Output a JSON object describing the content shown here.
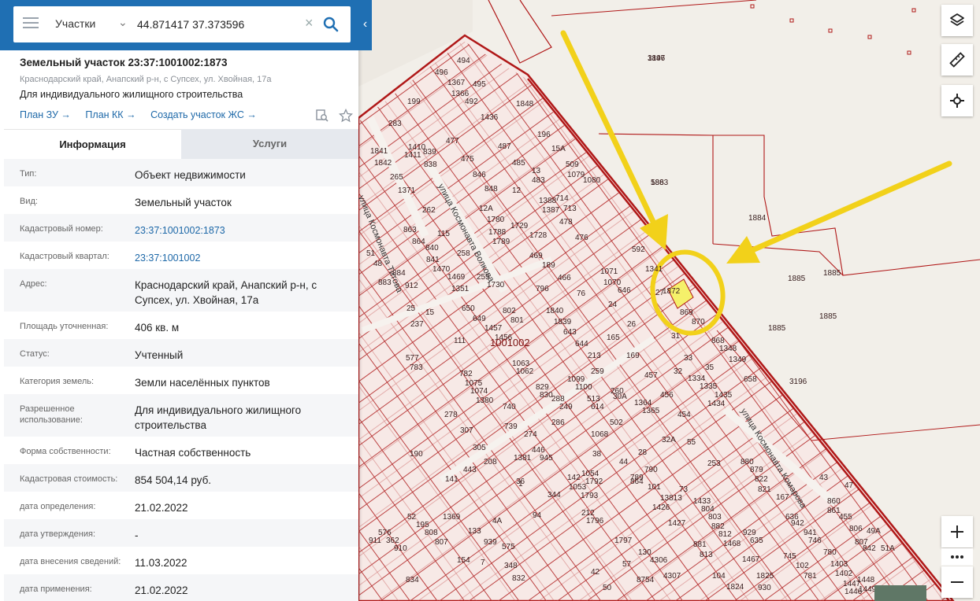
{
  "search": {
    "type_label": "Участки",
    "query": "44.871417 37.373596"
  },
  "header": {
    "title": "Земельный участок 23:37:1001002:1873",
    "address_short": "Краснодарский край, Анапский р-н, с Супсех, ул. Хвойная, 17а",
    "purpose": "Для индивидуального жилищного строительства",
    "links": [
      "План ЗУ →",
      "План КК →",
      "Создать участок ЖС →"
    ]
  },
  "tabs": {
    "info": "Информация",
    "services": "Услуги"
  },
  "rows": [
    {
      "label": "Тип:",
      "value": "Объект недвижимости"
    },
    {
      "label": "Вид:",
      "value": "Земельный участок"
    },
    {
      "label": "Кадастровый номер:",
      "value": "23:37:1001002:1873",
      "link": true
    },
    {
      "label": "Кадастровый квартал:",
      "value": "23:37:1001002",
      "link": true
    },
    {
      "label": "Адрес:",
      "value": "Краснодарский край, Анапский р-н, с Супсех, ул. Хвойная, 17а"
    },
    {
      "label": "Площадь уточненная:",
      "value": "406 кв. м"
    },
    {
      "label": "Статус:",
      "value": "Учтенный"
    },
    {
      "label": "Категория земель:",
      "value": "Земли населённых пунктов"
    },
    {
      "label": "Разрешенное использование:",
      "value": "Для индивидуального жилищного строительства"
    },
    {
      "label": "Форма собственности:",
      "value": "Частная собственность"
    },
    {
      "label": "Кадастровая стоимость:",
      "value": "854 504,14 руб."
    },
    {
      "label": "дата определения:",
      "value": "21.02.2022"
    },
    {
      "label": "дата утверждения:",
      "value": "-"
    },
    {
      "label": "дата внесения сведений:",
      "value": "11.03.2022"
    },
    {
      "label": "дата применения:",
      "value": "21.02.2022"
    }
  ],
  "map": {
    "quarter_label": "1001002",
    "streets": [
      "улица Космонавта Титова",
      "улица Космонавта Волкова",
      "улица Космонавта Комарова"
    ],
    "parcel_labels": [
      "3196",
      "1883",
      "1884",
      "1885",
      "1885",
      "1885",
      "1885",
      "3196",
      "1872",
      "869",
      "870",
      "868",
      "1348",
      "1349",
      "658",
      "1341",
      "592",
      "1071",
      "1070",
      "646",
      "76",
      "466",
      "796",
      "1840",
      "1839",
      "643",
      "644",
      "213",
      "165",
      "169",
      "24",
      "26",
      "27",
      "31",
      "33",
      "32",
      "35",
      "1334",
      "1335",
      "1435",
      "1434",
      "454",
      "456",
      "457",
      "1365",
      "1364",
      "259",
      "260",
      "30А",
      "32А",
      "55",
      "253",
      "73",
      "880",
      "879",
      "822",
      "821",
      "167",
      "860",
      "861",
      "43",
      "47",
      "455",
      "49А",
      "806",
      "807",
      "842",
      "51А",
      "1403",
      "1402",
      "1447",
      "1446",
      "1448",
      "1449",
      "190",
      "714",
      "713",
      "476",
      "478",
      "1388",
      "1387",
      "483",
      "13",
      "485",
      "487",
      "1436",
      "492",
      "495",
      "494",
      "496",
      "1367",
      "1366",
      "283",
      "199",
      "1410",
      "1411",
      "839",
      "838",
      "477",
      "475",
      "846",
      "848",
      "1841",
      "1842",
      "265",
      "1371",
      "863",
      "864",
      "840",
      "841",
      "1470",
      "1469",
      "258",
      "255",
      "1351",
      "1730",
      "115",
      "262",
      "912",
      "884",
      "883",
      "48",
      "51",
      "650",
      "649",
      "1457",
      "1456",
      "802",
      "801",
      "1063",
      "1062",
      "829",
      "830",
      "1099",
      "1100",
      "513",
      "614",
      "502",
      "1068",
      "286",
      "288",
      "249",
      "274",
      "446",
      "945",
      "740",
      "739",
      "278",
      "307",
      "305",
      "208",
      "141",
      "142",
      "1053",
      "1054",
      "1792",
      "1793",
      "212",
      "1796",
      "1797",
      "130",
      "57",
      "8754",
      "4306",
      "4307",
      "13813",
      "1426",
      "1427",
      "1433",
      "804",
      "803",
      "882",
      "881",
      "813",
      "812",
      "1468",
      "1467",
      "104",
      "1824",
      "1825",
      "930",
      "929",
      "635",
      "636",
      "942",
      "941",
      "746",
      "745",
      "102",
      "781",
      "780",
      "443",
      "1",
      "94",
      "344",
      "42",
      "50",
      "52",
      "195",
      "808",
      "807",
      "154",
      "133",
      "939",
      "575",
      "348",
      "832",
      "834",
      "362",
      "910",
      "911",
      "576",
      "577",
      "783",
      "782",
      "1075",
      "1074",
      "1380",
      "1381",
      "36",
      "38",
      "44",
      "28",
      "790",
      "789",
      "101",
      "864",
      "111",
      "25",
      "15",
      "237",
      "1369",
      "4А",
      "7",
      "12",
      "12А",
      "1780",
      "1788",
      "1789",
      "1729",
      "1728",
      "189",
      "469",
      "196",
      "15А",
      "509",
      "1080",
      "1079",
      "1848",
      "1847",
      "586"
    ]
  },
  "controls": [
    "layers-icon",
    "ruler-icon",
    "locate-icon",
    "zoom-in-icon",
    "more-icon",
    "zoom-out-icon"
  ]
}
